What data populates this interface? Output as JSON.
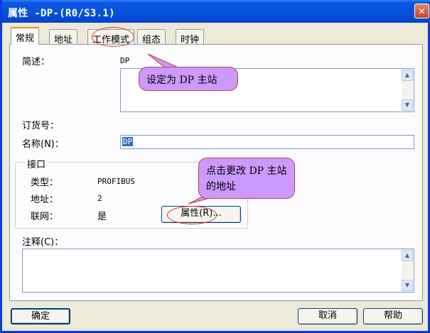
{
  "window": {
    "title": "属性 -DP-(R0/S3.1)",
    "close_glyph": "✕"
  },
  "tabs": [
    {
      "label": "常规"
    },
    {
      "label": "地址"
    },
    {
      "label": "工作模式"
    },
    {
      "label": "组态"
    },
    {
      "label": "时钟"
    }
  ],
  "form": {
    "description_label": "简述：",
    "description_value": "DP",
    "order_label": "订货号：",
    "name_label": "名称(N)：",
    "name_value": "DP",
    "comment_label": "注释(C)："
  },
  "interface": {
    "title": "接口",
    "type_label": "类型：",
    "type_value": "PROFIBUS",
    "address_label": "地址：",
    "address_value": "2",
    "network_label": "联网：",
    "network_value": "是",
    "properties_button": "属性(R)..."
  },
  "callouts": {
    "dp_master": "设定为 DP 主站",
    "change_address": "点击更改 DP 主站的地址"
  },
  "buttons": {
    "ok": "确定",
    "cancel": "取消",
    "help": "帮助"
  },
  "colors": {
    "titlebar": "#0a55e4",
    "callout_fill": "#cc99ff",
    "highlight_oval": "#e03030"
  }
}
